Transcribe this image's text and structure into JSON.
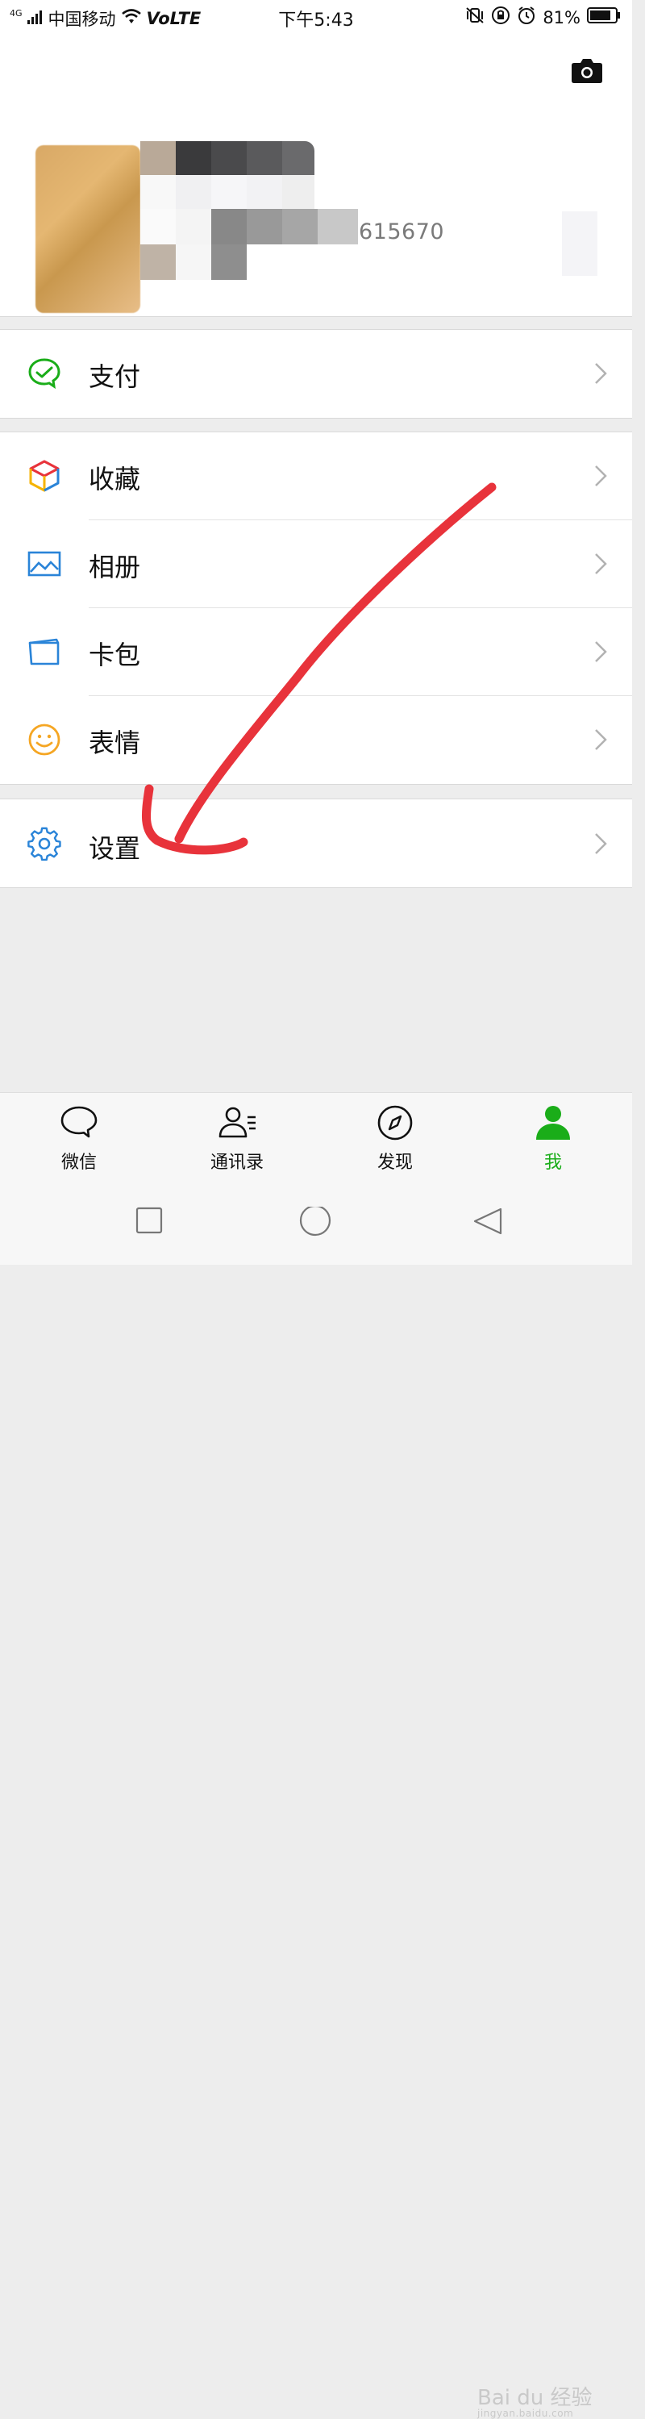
{
  "status_bar": {
    "signal": "4G",
    "carrier": "中国移动",
    "network": "VoLTE",
    "time": "下午5:43",
    "battery": "81%"
  },
  "profile": {
    "id_fragment": "615670",
    "camera_icon": "camera-icon"
  },
  "menu": {
    "pay": {
      "label": "支付",
      "icon": "wechat-pay-icon"
    },
    "favorites": {
      "label": "收藏",
      "icon": "cube-icon"
    },
    "album": {
      "label": "相册",
      "icon": "photo-icon"
    },
    "cards": {
      "label": "卡包",
      "icon": "card-icon"
    },
    "stickers": {
      "label": "表情",
      "icon": "smiley-icon"
    },
    "settings": {
      "label": "设置",
      "icon": "gear-icon"
    }
  },
  "tabs": [
    {
      "label": "微信",
      "icon": "chat-icon",
      "active": false
    },
    {
      "label": "通讯录",
      "icon": "contacts-icon",
      "active": false
    },
    {
      "label": "发现",
      "icon": "compass-icon",
      "active": false
    },
    {
      "label": "我",
      "icon": "person-icon",
      "active": true
    }
  ],
  "watermark": {
    "text": "Bai du 经验",
    "sub": "jingyan.baidu.com"
  },
  "colors": {
    "accent_green": "#1aad19",
    "annotation_red": "#e8333b",
    "icon_blue": "#2a84d8",
    "background": "#ededed"
  }
}
